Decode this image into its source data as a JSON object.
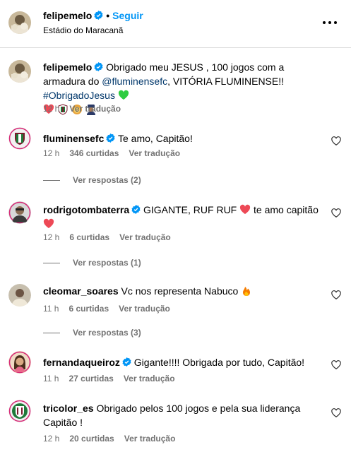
{
  "header": {
    "username": "felipemelo",
    "separator": "•",
    "follow_label": "Seguir",
    "location": "Estádio do Maracanã"
  },
  "caption": {
    "username": "felipemelo",
    "text_1": "Obrigado meu JESUS , 100 jogos com a armadura do ",
    "mention": "@fluminensefc",
    "text_2": ", VITÓRIA FLUMINENSE!! ",
    "hashtag": "#ObrigadoJesus",
    "time": "12 h",
    "translate": "Ver tradução"
  },
  "comments": [
    {
      "username": "fluminensefc",
      "verified": true,
      "text": "Te amo, Capitão!",
      "time": "12 h",
      "likes": "346 curtidas",
      "reply": "",
      "translate": "Ver tradução",
      "replies": "Ver respostas (2)"
    },
    {
      "username": "rodrigotombaterra",
      "verified": true,
      "text_1": "GIGANTE, RUF RUF",
      "text_2": "te amo capitão",
      "time": "12 h",
      "likes": "6 curtidas",
      "translate": "Ver tradução",
      "replies": "Ver respostas (1)"
    },
    {
      "username": "cleomar_soares",
      "verified": false,
      "text": "Vc nos representa Nabuco",
      "time": "11 h",
      "likes": "6 curtidas",
      "translate": "Ver tradução",
      "replies": "Ver respostas (3)"
    },
    {
      "username": "fernandaqueiroz",
      "verified": true,
      "text": "Gigante!!!! Obrigada por tudo, Capitão!",
      "time": "11 h",
      "likes": "27 curtidas",
      "translate": "Ver tradução"
    },
    {
      "username": "tricolor_es",
      "verified": false,
      "text_1": "Obrigado pelos 100 jogos e pela sua liderança",
      "text_2": "Capitão !",
      "time": "12 h",
      "likes": "20 curtidas",
      "translate": "Ver tradução"
    }
  ],
  "colors": {
    "link": "#00376b",
    "follow": "#0095f6",
    "verified": "#0095f6",
    "muted": "#737373",
    "heart_red": "#ed4956",
    "heart_green": "#2ecc40"
  }
}
